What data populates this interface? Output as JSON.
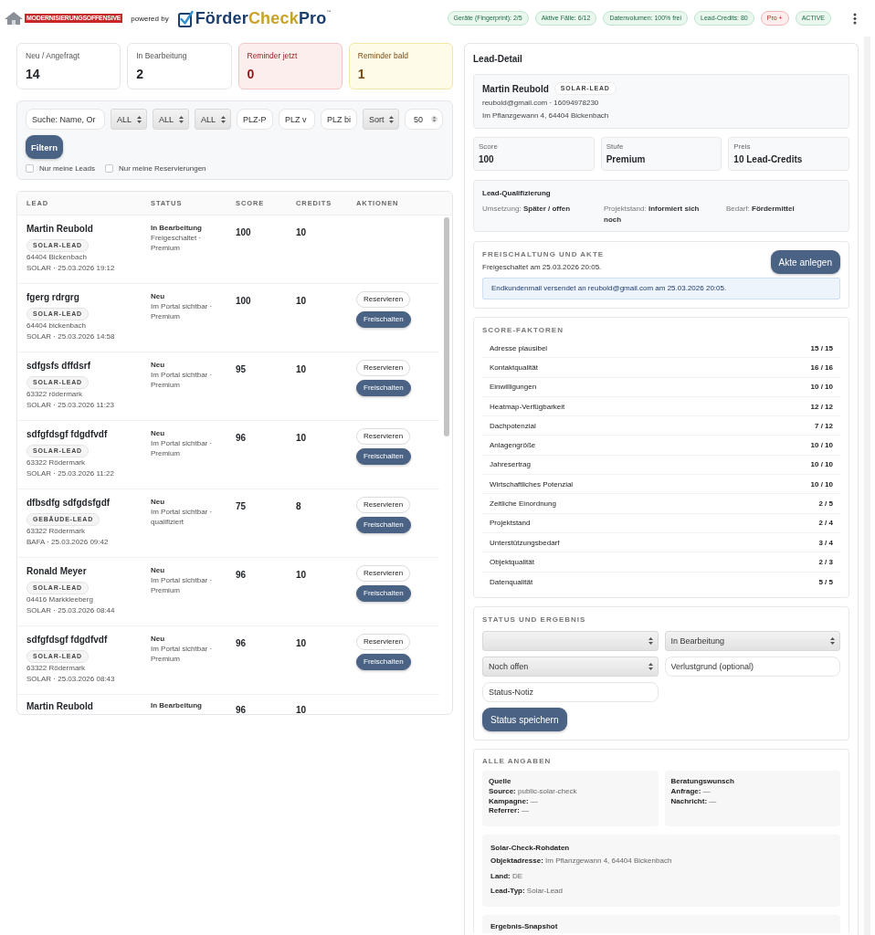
{
  "header": {
    "brand_badge": "MODERNISIERUNGSOFFENSIVE",
    "powered_by": "powered by",
    "logo": {
      "parts": [
        {
          "text": "Förder",
          "kind": "base"
        },
        {
          "text": "Check",
          "kind": "accent"
        },
        {
          "text": "Pro",
          "kind": "base"
        }
      ],
      "mark": "™"
    },
    "badges": [
      {
        "label": "Geräte (Fingerprint): 2/5",
        "kind": "info"
      },
      {
        "label": "Aktive Fälle: 6/12",
        "kind": "info"
      },
      {
        "label": "Datenvolumen: 100% frei",
        "kind": "info"
      },
      {
        "label": "Lead-Credits: 80",
        "kind": "info"
      },
      {
        "label": "Pro +",
        "kind": "plan"
      },
      {
        "label": "ACTIVE",
        "kind": "info"
      }
    ]
  },
  "stats": [
    {
      "label": "Neu / Angefragt",
      "value": "14",
      "kind": "neutral"
    },
    {
      "label": "In Bearbeitung",
      "value": "2",
      "kind": "neutral"
    },
    {
      "label": "Reminder jetzt",
      "value": "0",
      "kind": "alert"
    },
    {
      "label": "Reminder bald",
      "value": "1",
      "kind": "warning"
    }
  ],
  "filters": {
    "fields": [
      {
        "kind": "search",
        "placeholder": "Suche: Name, Or"
      },
      {
        "kind": "select",
        "value": "ALL"
      },
      {
        "kind": "select",
        "value": "ALL"
      },
      {
        "kind": "select",
        "value": "ALL"
      },
      {
        "kind": "text",
        "placeholder": "PLZ-P"
      },
      {
        "kind": "text",
        "placeholder": "PLZ v"
      },
      {
        "kind": "text",
        "placeholder": "PLZ bi"
      },
      {
        "kind": "select",
        "value": "Sort"
      },
      {
        "kind": "number",
        "value": "50"
      }
    ],
    "button": "Filtern",
    "checkboxes": [
      {
        "label": "Nur meine Leads",
        "checked": false
      },
      {
        "label": "Nur meine Reservierungen",
        "checked": false
      }
    ]
  },
  "table": {
    "columns": [
      "LEAD",
      "STATUS",
      "SCORE",
      "CREDITS",
      "AKTIONEN"
    ],
    "rows": [
      {
        "name": "Martin Reubold",
        "tag": "SOLAR-LEAD",
        "location": "64404 Bickenbach",
        "meta": "SOLAR · 25.03.2026 19:12",
        "status": "In Bearbeitung",
        "status_detail": "Freigeschaltet · Premium",
        "score": "100",
        "credits": "10"
      },
      {
        "name": "fgerg rdrgrg",
        "tag": "SOLAR-LEAD",
        "location": "64404 bickenbach",
        "meta": "SOLAR · 25.03.2026 14:58",
        "status": "Neu",
        "status_detail": "Im Portal sichtbar · Premium",
        "score": "100",
        "credits": "10",
        "actions": [
          {
            "label": "Reservieren",
            "kind": "secondary"
          },
          {
            "label": "Freischalten",
            "kind": "primary"
          }
        ]
      },
      {
        "name": "sdfgsfs dffdsrf",
        "tag": "SOLAR-LEAD",
        "location": "63322 rödermark",
        "meta": "SOLAR · 25.03.2026 11:23",
        "status": "Neu",
        "status_detail": "Im Portal sichtbar · Premium",
        "score": "95",
        "credits": "10",
        "actions": [
          {
            "label": "Reservieren",
            "kind": "secondary"
          },
          {
            "label": "Freischalten",
            "kind": "primary"
          }
        ]
      },
      {
        "name": "sdfgfdsgf fdgdfvdf",
        "tag": "SOLAR-LEAD",
        "location": "63322 Rödermark",
        "meta": "SOLAR · 25.03.2026 11:22",
        "status": "Neu",
        "status_detail": "Im Portal sichtbar · Premium",
        "score": "96",
        "credits": "10",
        "actions": [
          {
            "label": "Reservieren",
            "kind": "secondary"
          },
          {
            "label": "Freischalten",
            "kind": "primary"
          }
        ]
      },
      {
        "name": "dfbsdfg sdfgdsfgdf",
        "tag": "GEBÄUDE-LEAD",
        "location": "63322 Rödermark",
        "meta": "BAFA · 25.03.2026 09:42",
        "status": "Neu",
        "status_detail": "Im Portal sichtbar · qualifiziert",
        "score": "75",
        "credits": "8",
        "actions": [
          {
            "label": "Reservieren",
            "kind": "secondary"
          },
          {
            "label": "Freischalten",
            "kind": "primary"
          }
        ]
      },
      {
        "name": "Ronald Meyer",
        "tag": "SOLAR-LEAD",
        "location": "04416 Markkleeberg",
        "meta": "SOLAR · 25.03.2026 08:44",
        "status": "Neu",
        "status_detail": "Im Portal sichtbar · Premium",
        "score": "96",
        "credits": "10",
        "actions": [
          {
            "label": "Reservieren",
            "kind": "secondary"
          },
          {
            "label": "Freischalten",
            "kind": "primary"
          }
        ]
      },
      {
        "name": "sdfgfdsgf fdgdfvdf",
        "tag": "SOLAR-LEAD",
        "location": "63322 Rödermark",
        "meta": "SOLAR · 25.03.2026 08:43",
        "status": "Neu",
        "status_detail": "Im Portal sichtbar · Premium",
        "score": "96",
        "credits": "10",
        "actions": [
          {
            "label": "Reservieren",
            "kind": "secondary"
          },
          {
            "label": "Freischalten",
            "kind": "primary"
          }
        ]
      },
      {
        "name": "Martin Reubold",
        "status": "In Bearbeitung",
        "score": "96",
        "credits": "10"
      }
    ]
  },
  "detail": {
    "title": "Lead-Detail",
    "contact": {
      "name": "Martin Reubold",
      "tag": "SOLAR-LEAD",
      "contact_line": "reubold@gmail.com · 16094978230",
      "address": "Im Pflanzgewann 4, 64404 Bickenbach"
    },
    "metrics": [
      {
        "label": "Score",
        "value": "100"
      },
      {
        "label": "Stufe",
        "value": "Premium"
      },
      {
        "label": "Preis",
        "value": "10 Lead-Credits"
      }
    ],
    "qualification": {
      "title": "Lead-Qualifizierung",
      "items": [
        "Umsetzung: **Später / offen**",
        "Projektstand: **Informiert sich noch**",
        "Bedarf: **Fördermittel**"
      ]
    },
    "unlock": {
      "title": "FREISCHALTUNG UND AKTE",
      "text": "Freigeschaltet am 25.03.2026 20:05.",
      "button": "Akte anlegen",
      "notice": "Endkundenmail versendet an reubold@gmail.com am 25.03.2026 20:05."
    },
    "score_factors": {
      "title": "SCORE-FAKTOREN",
      "rows": [
        {
          "label": "Adresse plausibel",
          "value": "15 / 15"
        },
        {
          "label": "Kontaktqualität",
          "value": "16 / 16"
        },
        {
          "label": "Einwilligungen",
          "value": "10 / 10"
        },
        {
          "label": "Heatmap-Verfügbarkeit",
          "value": "12 / 12"
        },
        {
          "label": "Dachpotenzial",
          "value": "7 / 12"
        },
        {
          "label": "Anlagengröße",
          "value": "10 / 10"
        },
        {
          "label": "Jahresertrag",
          "value": "10 / 10"
        },
        {
          "label": "Wirtschaftliches Potenzial",
          "value": "10 / 10"
        },
        {
          "label": "Zeitliche Einordnung",
          "value": "2 / 5"
        },
        {
          "label": "Projektstand",
          "value": "2 / 4"
        },
        {
          "label": "Unterstützungsbedarf",
          "value": "3 / 4"
        },
        {
          "label": "Objektqualität",
          "value": "2 / 3"
        },
        {
          "label": "Datenqualität",
          "value": "5 / 5"
        }
      ]
    },
    "status": {
      "title": "STATUS UND ERGEBNIS",
      "fields": [
        {
          "kind": "select"
        },
        {
          "kind": "select",
          "value": "In Bearbeitung"
        },
        {
          "kind": "select",
          "value": "Noch offen"
        },
        {
          "kind": "text",
          "placeholder": "Verlustgrund (optional)"
        },
        {
          "kind": "text",
          "placeholder": "Status-Notiz"
        }
      ],
      "button": "Status speichern"
    },
    "all_data": {
      "title": "ALLE ANGABEN",
      "groups": [
        {
          "title": "Quelle",
          "kind": "half",
          "lines": [
            "**Source:** public-solar-check",
            "**Kampagne:** —",
            "**Referrer:** —"
          ]
        },
        {
          "title": "Beratungswunsch",
          "kind": "half",
          "lines": [
            "**Anfrage:** —",
            "**Nachricht:** —"
          ]
        },
        {
          "title": "Solar-Check-Rohdaten",
          "kind": "full",
          "lines": [
            "**Objektadresse:** Im Pflanzgewann 4, 64404 Bickenbach",
            "**Land:** DE",
            "**Lead-Typ:** Solar-Lead"
          ]
        },
        {
          "title": "Ergebnis-Snapshot",
          "kind": "full"
        }
      ]
    }
  }
}
